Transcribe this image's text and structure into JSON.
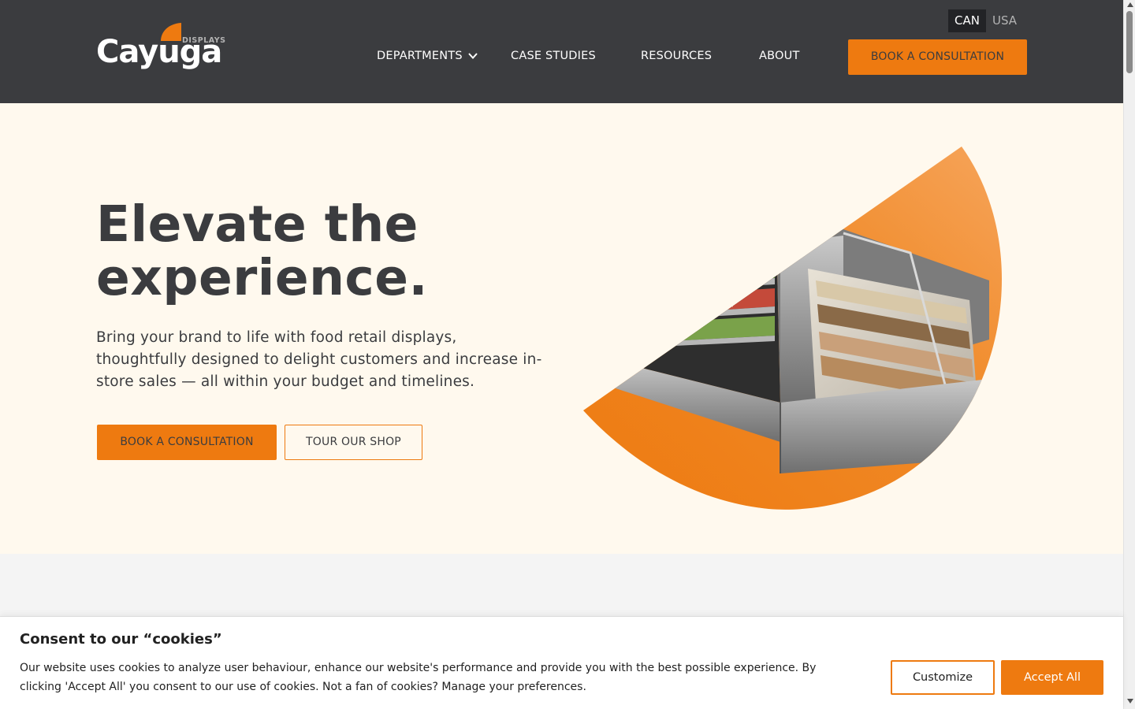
{
  "header": {
    "logo": {
      "wordmark": "Cayuga",
      "tagline": "DISPLAYS"
    },
    "locale": {
      "options": [
        "CAN",
        "USA"
      ],
      "selected": "CAN"
    },
    "nav": {
      "departments": "DEPARTMENTS",
      "case_studies": "CASE STUDIES",
      "resources": "RESOURCES",
      "about": "ABOUT"
    },
    "cta_label": "BOOK A CONSULTATION"
  },
  "hero": {
    "title_line1": "Elevate the",
    "title_line2": "experience.",
    "subtitle": "Bring your brand to life with food retail displays, thoughtfully designed to delight customers and increase in-store sales — all within your budget and timelines.",
    "primary_cta": "BOOK A CONSULTATION",
    "secondary_cta": "TOUR OUR SHOP"
  },
  "cookie_banner": {
    "title": "Consent to our “cookies”",
    "text": "Our website uses cookies to analyze user behaviour, enhance our website's performance and provide you with the best possible experience. By clicking 'Accept All' you consent to our use of cookies. Not a fan of cookies? Manage your preferences.",
    "customize_label": "Customize",
    "accept_label": "Accept All"
  },
  "colors": {
    "header_bg": "#3b3c3f",
    "accent": "#ee7a10",
    "hero_bg": "#fff9ee",
    "page_bg": "#f4f4f4"
  },
  "icons": [
    "chevron-down-icon",
    "logo-leaf-icon",
    "scroll-up-icon",
    "scroll-down-icon"
  ]
}
